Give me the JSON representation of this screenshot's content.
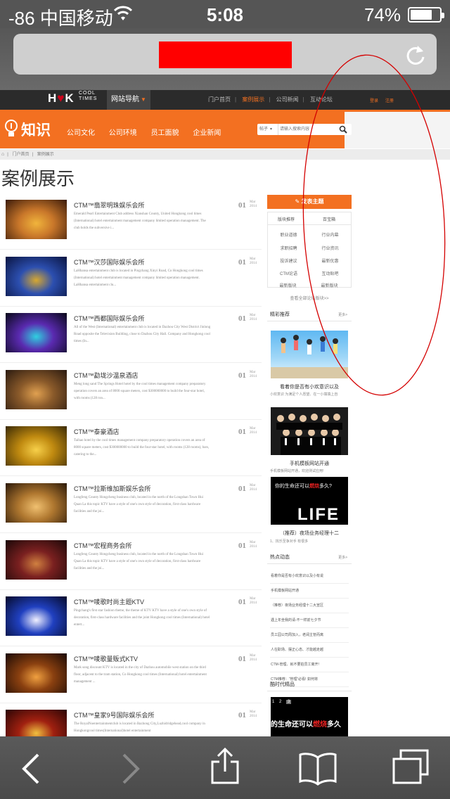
{
  "status_bar": {
    "carrier": "-86 中国移动",
    "time": "5:08",
    "battery_pct": "74%",
    "battery_level": 0.74
  },
  "browser": {
    "reload_icon": "reload-icon"
  },
  "site": {
    "logo": {
      "letters_h": "H",
      "letters_k": "K",
      "cool": "COOL",
      "times": "TIMES",
      "tm": "TM"
    },
    "site_nav": "网站导航",
    "top_links": [
      "门户首页",
      "案例展示",
      "公司新闻",
      "互动论坛"
    ],
    "auth": {
      "login": "登录",
      "register": "注册"
    },
    "brand": "知识",
    "categories": [
      "公司文化",
      "公司环境",
      "员工面貌",
      "企业新闻"
    ],
    "search": {
      "select": "帖子",
      "placeholder": "请输入搜索内容"
    },
    "breadcrumb": [
      "门户首页",
      "案例展示"
    ],
    "page_title": "案例展示"
  },
  "cases": [
    {
      "title": "CTM™翡翠明珠娱乐会所",
      "desc": "Emerald Pearl Entertainment Club address Xianshan County, United Hongkong cool times (International) hotel entertainment management company limited operation management. The club holds the subversive i...",
      "day": "01",
      "month": "Mar",
      "year": "2014"
    },
    {
      "title": "CTM™汉莎国际娱乐会所",
      "desc": "LaHhansa entertainment club is located in Pingchang Xinyi Road, Co Hongkong cool times (International) hotel entertainment management company limited operation management. LaHhansa entertainment clu...",
      "day": "01",
      "month": "Mar",
      "year": "2014"
    },
    {
      "title": "CTM™西都国际娱乐会所",
      "desc": "All of the West (International) entertainment club is located in Dazhou City West District Jinlong Road opposite the Television Building, close to Dazhou City Hall. Company and Hongkong cool times (In...",
      "day": "01",
      "month": "Mar",
      "year": "2014"
    },
    {
      "title": "CTM™勐垅沙温泉酒店",
      "desc": "Meng long sand The Springs Hotel hotel by the cool times management company preparatory operation covers an area of 8000 square meters, cost $300000000 to build the four-star hotel, with rooms (128 roo...",
      "day": "01",
      "month": "Mar",
      "year": "2014"
    },
    {
      "title": "CTM™泰豪酒店",
      "desc": "Taihao hotel by the cool times management company preparatory operation covers an area of 8000 square meters, cost $300000000 to build the four-star hotel, with rooms (128 rooms), bars, catering to the...",
      "day": "01",
      "month": "Mar",
      "year": "2014"
    },
    {
      "title": "CTM™拉斯维加斯娱乐会所",
      "desc": "Longfeng County Hongcheng business club, located in the north of the Longshan Town Hui Quan La this topic KTV have a style of one's own style of decoration, first-class hardware facilities and the joi...",
      "day": "01",
      "month": "Mar",
      "year": "2014"
    },
    {
      "title": "CTM™宏程商务会所",
      "desc": "Longfeng County Hongcheng business club, located in the north of the Longshan Town Hui Quan La this topic KTV have a style of one's own style of decoration, first-class hardware facilities and the joi...",
      "day": "01",
      "month": "Mar",
      "year": "2014"
    },
    {
      "title": "CTM™唛歌时尚主题KTV",
      "desc": "Pingchang's first star fashion theme, the theme of KTV KTV have a style of one's own style of decoration, first-class hardware facilities and the joint Hongkong cool times (International) hotel entert...",
      "day": "01",
      "month": "Mar",
      "year": "2014"
    },
    {
      "title": "CTM™唛歌量贩式KTV",
      "desc": "Mark song discount KTV is located in the city of Dazhou automobile west station on the third floor, adjacent to the tram station, Co Hongkong cool times (International) hotel entertainment management ...",
      "day": "01",
      "month": "Mar",
      "year": "2014"
    },
    {
      "title": "CTM™皇家9号国际娱乐会所",
      "desc": "The RoyalNoentertainmentclub is located in Bazhong City,Luzhidridgehead,cool company in Hongkongcool times(International)hotel entertainment",
      "day": "01",
      "month": "Mar",
      "year": "2014"
    }
  ],
  "sidebar": {
    "post_button": "发表主题",
    "forum_tabs": [
      "版块推荐",
      "百宝箱"
    ],
    "forum_cells": [
      "职业道德",
      "行业内幕",
      "求职招聘",
      "行业资讯",
      "投诉建议",
      "最新优惠",
      "CTM论语",
      "互动贴吧",
      "最新版块",
      "最新版块"
    ],
    "forum_more": "查看全部论坛版块>>",
    "featured": {
      "title": "精彩推荐",
      "more": "更多>",
      "items": [
        {
          "caption": "看着你是否有小欢意识以及",
          "sub": "小欢意识 为满足个人愿望、在一小填填上自"
        },
        {
          "caption": "手机模板网站开通",
          "sub": "手机模板网站开通，欢迎测试应用!"
        },
        {
          "caption": "（推荐）夜场业务经理十二",
          "sub": "1、找乐至争对手 有很多"
        }
      ],
      "poster_text": {
        "line1": "你的生命还可以",
        "hot": "燃烧",
        "line1b": "多久?",
        "life": "LIFE"
      }
    },
    "hot": {
      "title": "热点动态",
      "more": "更多>",
      "items": [
        "看着你是否有小欢意识以及小有说",
        "手机模板网站开通",
        "（推荐）夜场业务经理十二大宣区",
        "遇上年坐我的请-不一样前七夕节",
        "员工园公司周加入，老阔主管而离",
        "人在职场、摆正心态、才能越走越",
        "CTM-管理、就不要拍员工离开!",
        "CTM推荐：“管理”必看! 如何将"
      ]
    },
    "era": {
      "title": "酷时代精品",
      "pager": [
        "1",
        "2",
        "3"
      ],
      "banner": {
        "lead": "的生命还可以",
        "hot": "燃烧",
        "tail": "多久"
      }
    }
  },
  "toolbar": {
    "icons": [
      "back-icon",
      "forward-icon",
      "share-icon",
      "bookmarks-icon",
      "tabs-icon"
    ]
  },
  "annotation": {
    "shape": "ellipse",
    "color": "#d40000"
  }
}
